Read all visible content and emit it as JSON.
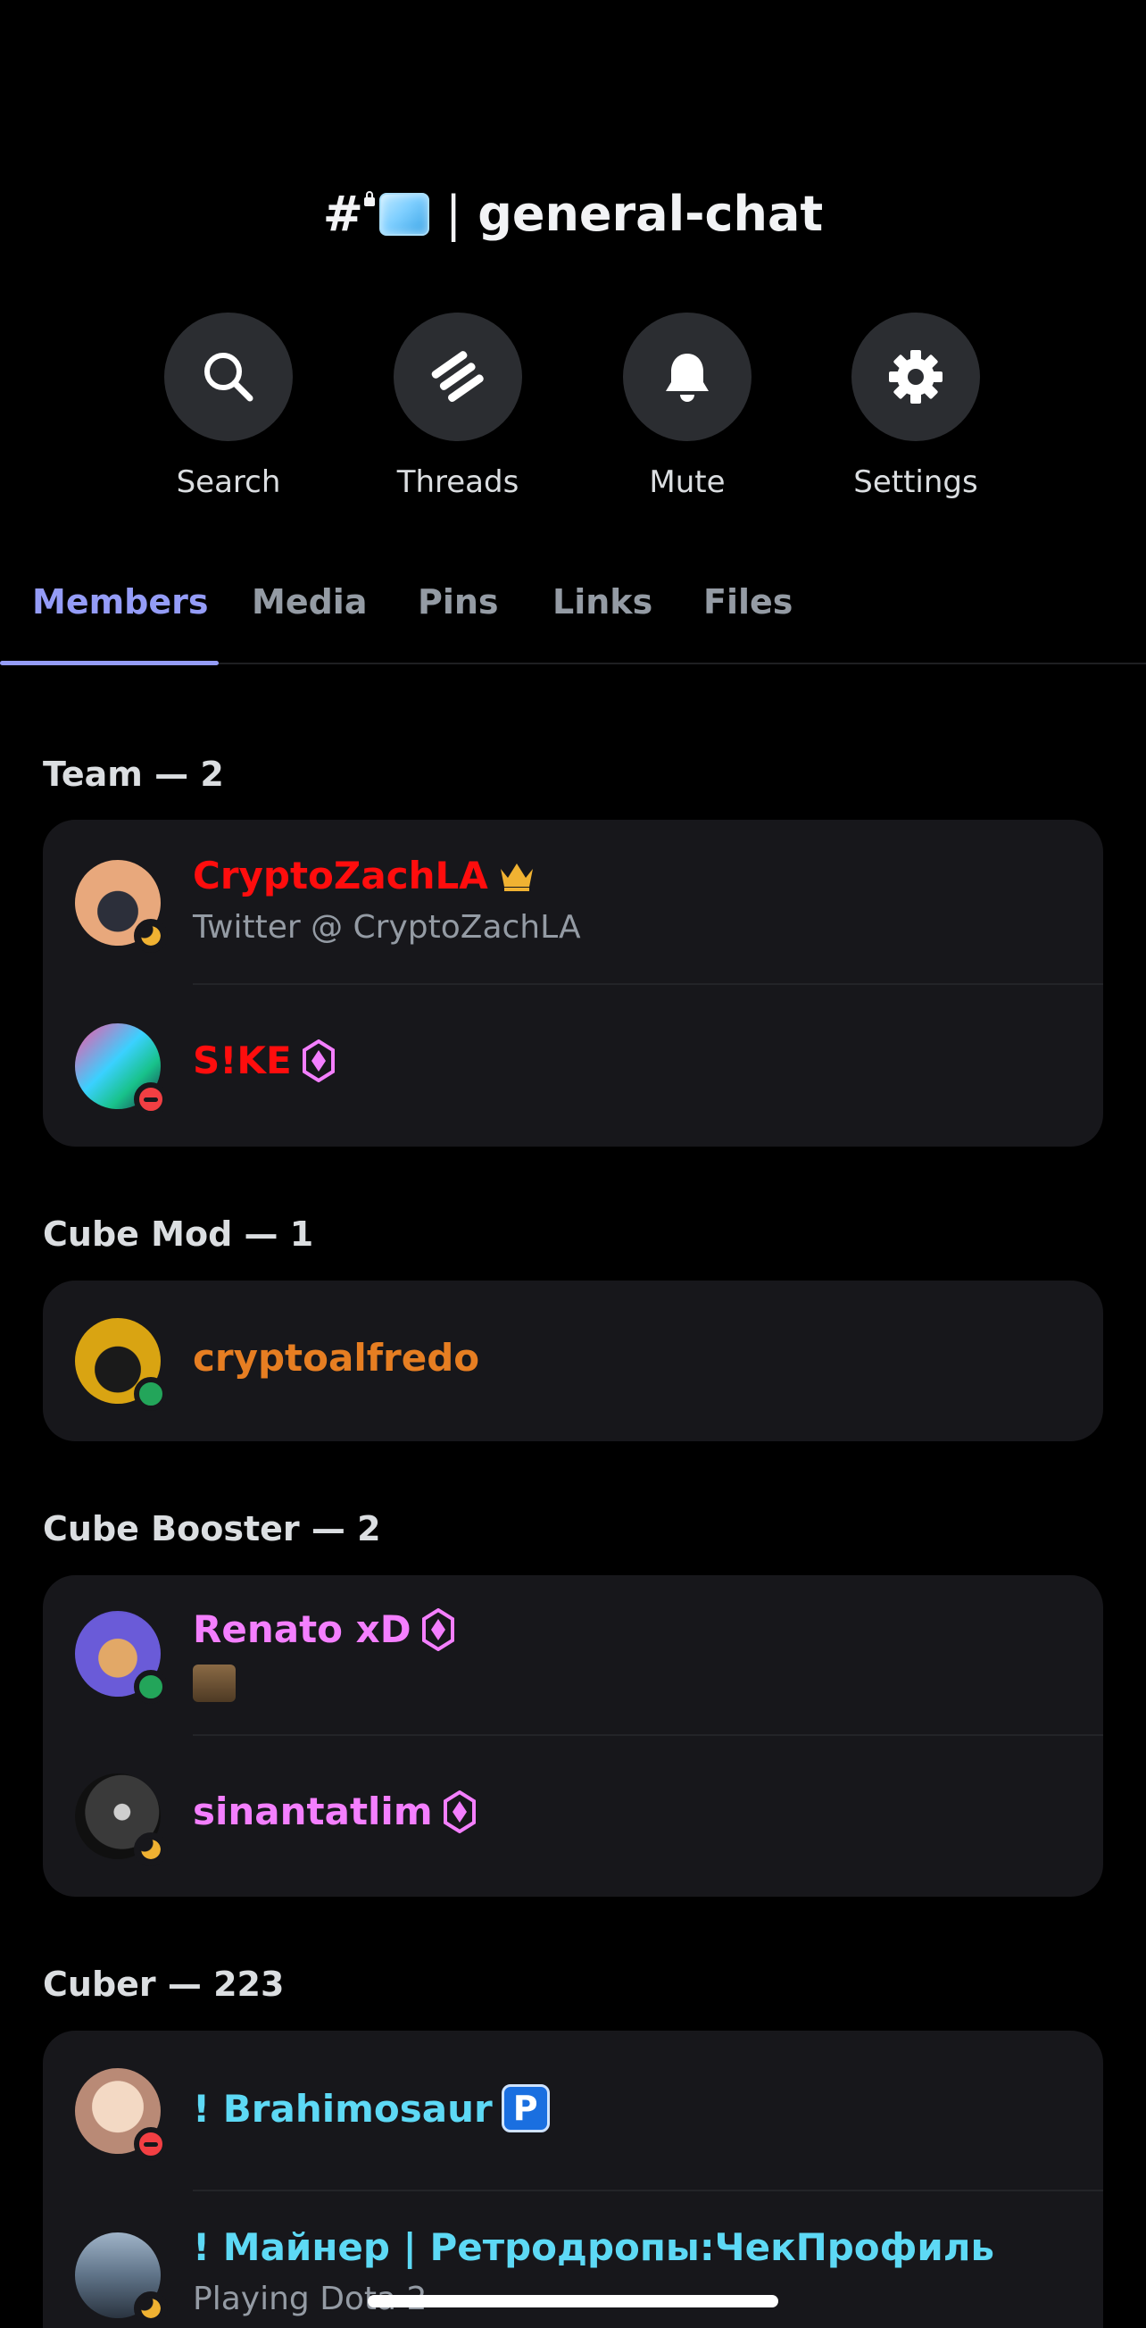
{
  "header": {
    "channel_prefix": "#",
    "separator": "|",
    "channel_name": "general-chat"
  },
  "actions": [
    {
      "label": "Search",
      "icon": "search-icon"
    },
    {
      "label": "Threads",
      "icon": "threads-icon"
    },
    {
      "label": "Mute",
      "icon": "bell-icon"
    },
    {
      "label": "Settings",
      "icon": "gear-icon"
    }
  ],
  "tabs": [
    {
      "label": "Members",
      "active": true
    },
    {
      "label": "Media"
    },
    {
      "label": "Pins"
    },
    {
      "label": "Links"
    },
    {
      "label": "Files"
    }
  ],
  "sections": [
    {
      "title": "Team — 2",
      "members": [
        {
          "name": "CryptoZachLA",
          "subtitle": "Twitter @ CryptoZachLA",
          "status": "idle",
          "color": "#ff0d0d",
          "badge": "crown-icon"
        },
        {
          "name": "S!KE",
          "status": "dnd",
          "color": "#ff0d0d",
          "badge": "boost-icon"
        }
      ]
    },
    {
      "title": "Cube Mod — 1",
      "members": [
        {
          "name": "cryptoalfredo",
          "status": "online",
          "color": "#e67e22"
        }
      ]
    },
    {
      "title": "Cube Booster — 2",
      "members": [
        {
          "name": "Renato xD",
          "status": "online",
          "color": "#f47fff",
          "badge": "boost-icon",
          "custom_status_icon": "emoji-icon"
        },
        {
          "name": "sinantatlim",
          "status": "idle",
          "color": "#f47fff",
          "badge": "boost-icon"
        }
      ]
    },
    {
      "title": "Cuber — 223",
      "members": [
        {
          "name": "! Brahimosaur",
          "status": "dnd",
          "color": "#5dd9f5",
          "badge": "p-badge",
          "badge_text": "P"
        },
        {
          "name": "! Майнер | Ретродропы:ЧекПрофиль",
          "subtitle": "Playing Dota 2",
          "status": "idle",
          "color": "#5dd9f5"
        }
      ]
    }
  ],
  "colors": {
    "background": "#000000",
    "card": "#17171b",
    "accent": "#949cf7",
    "muted_text": "#949ba4",
    "idle": "#f0b232",
    "online": "#23a55a",
    "dnd": "#f23f43"
  }
}
